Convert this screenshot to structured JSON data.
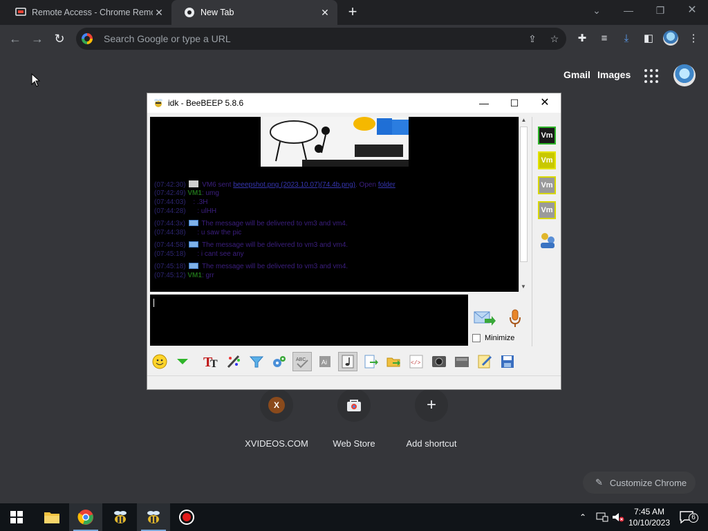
{
  "browser": {
    "tabs": [
      {
        "title": "Remote Access - Chrome Remote Desktop",
        "active": false
      },
      {
        "title": "New Tab",
        "active": true
      }
    ],
    "omnibox_placeholder": "Search Google or type a URL",
    "toplinks": {
      "gmail": "Gmail",
      "images": "Images"
    }
  },
  "shortcuts": [
    {
      "label": "XVIDEOS.COM",
      "letter": "X"
    },
    {
      "label": "Web Store",
      "letter": ""
    },
    {
      "label": "Add shortcut",
      "letter": "+"
    }
  ],
  "customize_label": "Customize Chrome",
  "beebeep": {
    "title": "idk - BeeBEEP 5.8.6",
    "chat_lines": [
      {
        "ts": "(07:42:30)",
        "kind": "file",
        "text": "VM6 sent ",
        "link": "beeepshot.png (2023.10.07)(74.4b.png)",
        "after": ". Open ",
        "link2": "folder"
      },
      {
        "ts": "(07:42:49)",
        "kind": "msg",
        "name": "VM1",
        "text": ": umg"
      },
      {
        "ts": "(07:44:03)",
        "kind": "plain",
        "text": ": .3H"
      },
      {
        "ts": "(07:44:28)",
        "kind": "plain",
        "text": ": ulHH"
      },
      {
        "ts": "(07:44:3x)",
        "kind": "notice",
        "text": "The message will be delivered to vm3 and vm4."
      },
      {
        "ts": "(07:44:38)",
        "kind": "plain",
        "text": ": u saw the pic"
      },
      {
        "ts": "(07:44:58)",
        "kind": "notice",
        "text": "The message will be delivered to vm3 and vm4."
      },
      {
        "ts": "(07:45:18)",
        "kind": "plain",
        "text": ": i cant see any"
      },
      {
        "ts": "(07:45:18)",
        "kind": "notice",
        "text": "The message will be delivered to vm3 and vm4."
      },
      {
        "ts": "(07:45:12)",
        "kind": "msg",
        "name": "VM1",
        "text": ": grr"
      }
    ],
    "minimize_label": "Minimize",
    "users": [
      {
        "label": "Vm",
        "bg": "#1a1a1a",
        "border": "#2fb52a"
      },
      {
        "label": "Vm",
        "bg": "#c8c800",
        "border": "#e3e300"
      },
      {
        "label": "Vm",
        "bg": "#9a9a9a",
        "border": "#d7d700"
      },
      {
        "label": "Vm",
        "bg": "#9a9a9a",
        "border": "#d7d700"
      }
    ]
  },
  "taskbar": {
    "time": "7:45 AM",
    "date": "10/10/2023",
    "notif_count": "6"
  }
}
